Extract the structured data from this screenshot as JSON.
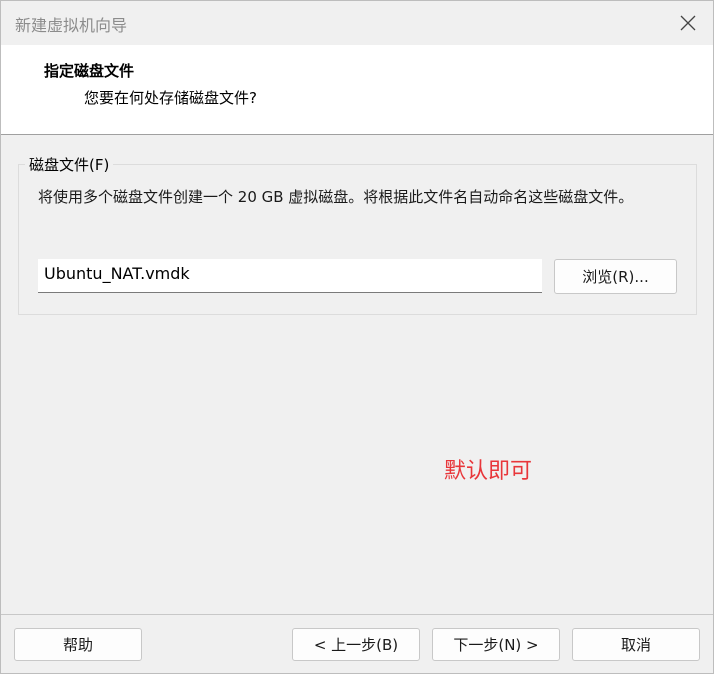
{
  "window": {
    "title": "新建虚拟机向导"
  },
  "header": {
    "title": "指定磁盘文件",
    "subtitle": "您要在何处存储磁盘文件?"
  },
  "disk_file_group": {
    "legend": "磁盘文件(F)",
    "description": "将使用多个磁盘文件创建一个 20 GB 虚拟磁盘。将根据此文件名自动命名这些磁盘文件。",
    "filename_value": "Ubuntu_NAT.vmdk",
    "browse_label": "浏览(R)..."
  },
  "annotation": {
    "text": "默认即可",
    "color": "#e8363a"
  },
  "footer": {
    "help_label": "帮助",
    "back_label": "< 上一步(B)",
    "next_label": "下一步(N) >",
    "cancel_label": "取消"
  },
  "icons": {
    "close": "close-icon"
  }
}
